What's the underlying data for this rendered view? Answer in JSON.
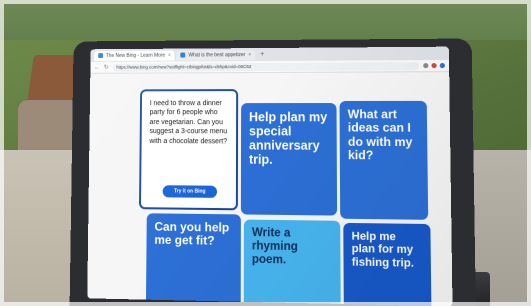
{
  "browser": {
    "tabs": [
      {
        "label": "The New Bing - Learn More",
        "active": true
      },
      {
        "label": "What is the best appetizer",
        "active": false
      }
    ],
    "new_tab_label": "+",
    "url": "https://www.bing.com/new?setflight=cibingpilot&ls=dshp&cvid=06C52"
  },
  "cards": {
    "dinner_prompt": "I need to throw a dinner party for 6 people who are vegetarian. Can you suggest a 3-course menu with a chocolate dessert?",
    "try_button": "Try it on Bing",
    "anniversary": "Help plan my special anniversary trip.",
    "art_ideas": "What art ideas can I do with my kid?",
    "get_fit": "Can you help me get fit?",
    "poem": "Write a rhyming poem.",
    "fishing": "Help me plan for my fishing trip."
  },
  "colors": {
    "card_blue": "#2c6fd6",
    "card_cyan": "#47b4ef",
    "card_navy": "#1758c9",
    "bezel": "#2b2d31"
  }
}
